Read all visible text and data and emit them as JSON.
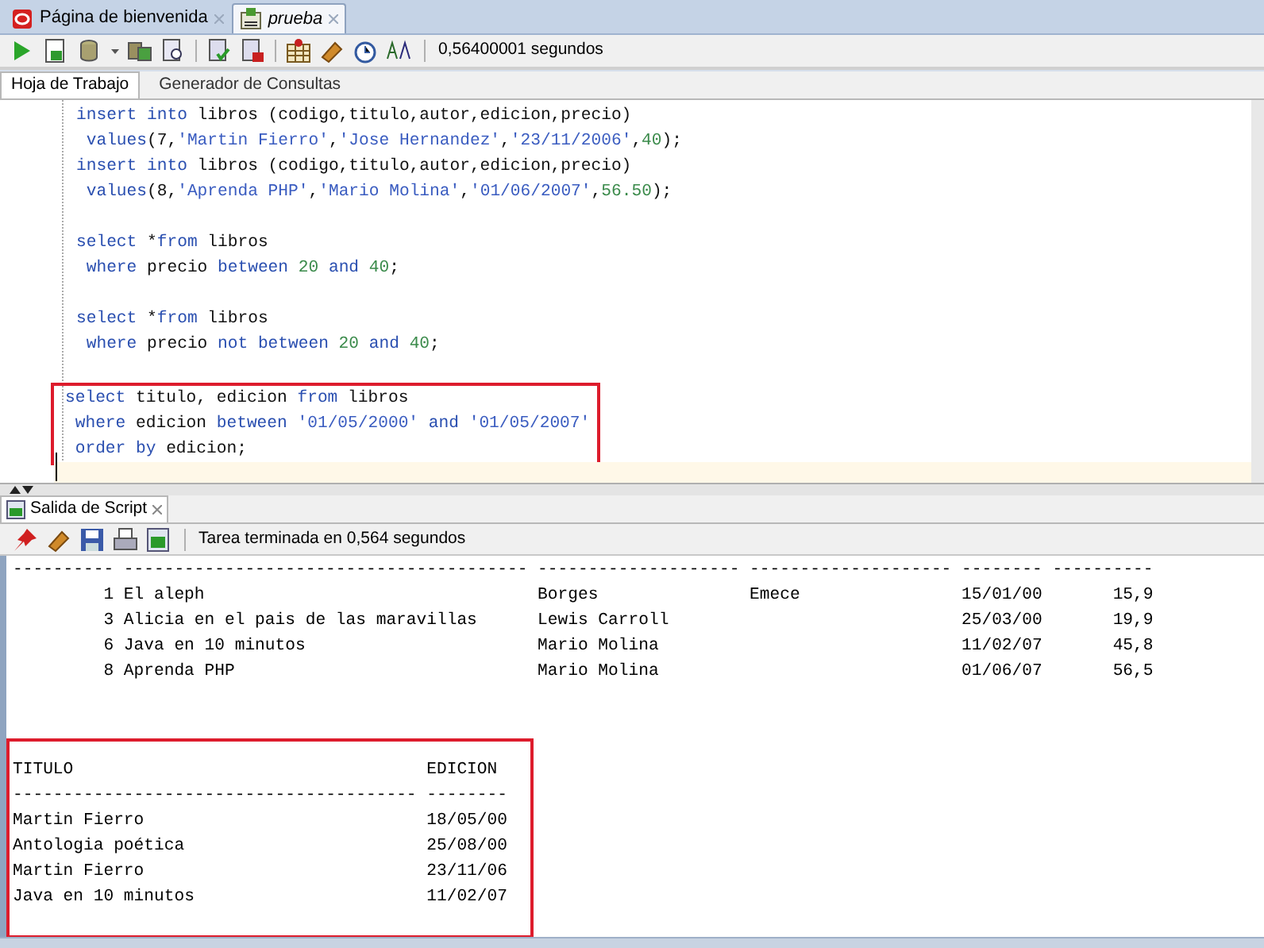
{
  "doc_tabs": [
    {
      "label": "Página de bienvenida",
      "selected": false,
      "unsaved": false
    },
    {
      "label": "prueba",
      "selected": true,
      "unsaved": true
    }
  ],
  "toolbar": {
    "elapsed": "0,56400001 segundos"
  },
  "editor_tabs": [
    {
      "label": "Hoja de Trabajo",
      "selected": true
    },
    {
      "label": "Generador de Consultas",
      "selected": false
    }
  ],
  "editor": {
    "statements": [
      {
        "highlighted": false,
        "lines": [
          [
            {
              "kind": "keyword",
              "text": "insert into"
            },
            {
              "kind": "plain",
              "text": " libros (codigo,titulo,autor,edicion,precio)"
            }
          ],
          [
            {
              "kind": "keyword",
              "text": " values"
            },
            {
              "kind": "plain",
              "text": "(7,"
            },
            {
              "kind": "string",
              "text": "'Martin Fierro'"
            },
            {
              "kind": "plain",
              "text": ","
            },
            {
              "kind": "string",
              "text": "'Jose Hernandez'"
            },
            {
              "kind": "plain",
              "text": ","
            },
            {
              "kind": "string",
              "text": "'23/11/2006'"
            },
            {
              "kind": "plain",
              "text": ","
            },
            {
              "kind": "number",
              "text": "40"
            },
            {
              "kind": "plain",
              "text": ");"
            }
          ],
          [
            {
              "kind": "keyword",
              "text": "insert into"
            },
            {
              "kind": "plain",
              "text": " libros (codigo,titulo,autor,edicion,precio)"
            }
          ],
          [
            {
              "kind": "keyword",
              "text": " values"
            },
            {
              "kind": "plain",
              "text": "(8,"
            },
            {
              "kind": "string",
              "text": "'Aprenda PHP'"
            },
            {
              "kind": "plain",
              "text": ","
            },
            {
              "kind": "string",
              "text": "'Mario Molina'"
            },
            {
              "kind": "plain",
              "text": ","
            },
            {
              "kind": "string",
              "text": "'01/06/2007'"
            },
            {
              "kind": "plain",
              "text": ","
            },
            {
              "kind": "number",
              "text": "56.50"
            },
            {
              "kind": "plain",
              "text": ");"
            }
          ]
        ]
      },
      {
        "highlighted": false,
        "lines": [
          [
            {
              "kind": "keyword",
              "text": "select"
            },
            {
              "kind": "plain",
              "text": " *"
            },
            {
              "kind": "keyword",
              "text": "from"
            },
            {
              "kind": "plain",
              "text": " libros"
            }
          ],
          [
            {
              "kind": "keyword",
              "text": " where"
            },
            {
              "kind": "plain",
              "text": " precio "
            },
            {
              "kind": "keyword",
              "text": "between"
            },
            {
              "kind": "number",
              "text": " 20"
            },
            {
              "kind": "keyword",
              "text": " and"
            },
            {
              "kind": "number",
              "text": " 40"
            },
            {
              "kind": "plain",
              "text": ";"
            }
          ]
        ]
      },
      {
        "highlighted": false,
        "lines": [
          [
            {
              "kind": "keyword",
              "text": "select"
            },
            {
              "kind": "plain",
              "text": " *"
            },
            {
              "kind": "keyword",
              "text": "from"
            },
            {
              "kind": "plain",
              "text": " libros"
            }
          ],
          [
            {
              "kind": "keyword",
              "text": " where"
            },
            {
              "kind": "plain",
              "text": " precio "
            },
            {
              "kind": "keyword",
              "text": "not between"
            },
            {
              "kind": "number",
              "text": " 20"
            },
            {
              "kind": "keyword",
              "text": " and"
            },
            {
              "kind": "number",
              "text": " 40"
            },
            {
              "kind": "plain",
              "text": ";"
            }
          ]
        ]
      },
      {
        "highlighted": true,
        "lines": [
          [
            {
              "kind": "keyword",
              "text": "select"
            },
            {
              "kind": "plain",
              "text": " titulo, edicion "
            },
            {
              "kind": "keyword",
              "text": "from"
            },
            {
              "kind": "plain",
              "text": " libros"
            }
          ],
          [
            {
              "kind": "keyword",
              "text": " where"
            },
            {
              "kind": "plain",
              "text": " edicion "
            },
            {
              "kind": "keyword",
              "text": "between"
            },
            {
              "kind": "string",
              "text": " '01/05/2000'"
            },
            {
              "kind": "keyword",
              "text": " and"
            },
            {
              "kind": "string",
              "text": " '01/05/2007'"
            }
          ],
          [
            {
              "kind": "keyword",
              "text": " order by"
            },
            {
              "kind": "plain",
              "text": " edicion;"
            }
          ]
        ]
      }
    ]
  },
  "output": {
    "tab": "Salida de Script",
    "status": "Tarea terminada en 0,564 segundos",
    "results": [
      {
        "highlighted": false,
        "rows": [
          [
            "----------",
            "----------------------------------------",
            "--------------------",
            "--------------------",
            "--------",
            "----------"
          ],
          [
            "1",
            "El aleph",
            "Borges",
            "Emece",
            "15/01/00",
            "15,9"
          ],
          [
            "3",
            "Alicia en el pais de las maravillas",
            "Lewis Carroll",
            "",
            "25/03/00",
            "19,9"
          ],
          [
            "6",
            "Java en 10 minutos",
            "Mario Molina",
            "",
            "11/02/07",
            "45,8"
          ],
          [
            "8",
            "Aprenda PHP",
            "Mario Molina",
            "",
            "01/06/07",
            "56,5"
          ]
        ]
      },
      {
        "highlighted": true,
        "rows": [
          [
            "TITULO",
            "EDICION"
          ],
          [
            "----------------------------------------",
            "--------"
          ],
          [
            "Martin Fierro",
            "18/05/00"
          ],
          [
            "Antologia poética",
            "25/08/00"
          ],
          [
            "Martin Fierro",
            "23/11/06"
          ],
          [
            "Java en 10 minutos",
            "11/02/07"
          ]
        ]
      }
    ]
  }
}
